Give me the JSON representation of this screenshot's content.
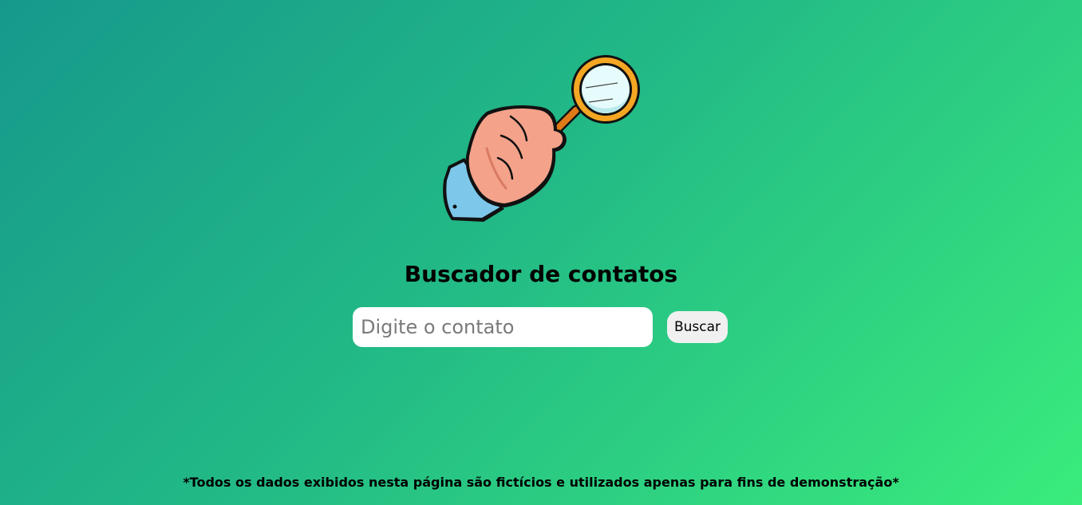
{
  "hero": {
    "icon": "hand-holding-magnifying-glass-icon"
  },
  "page": {
    "title": "Buscador de contatos"
  },
  "search": {
    "placeholder": "Digite o contato",
    "value": "",
    "button_label": "Buscar"
  },
  "footer": {
    "disclaimer": "*Todos os dados exibidos nesta página são fictícios e utilizados apenas para fins de demonstração*"
  },
  "colors": {
    "gradient_start": "#16998c",
    "gradient_end": "#3aec7c",
    "input_background": "#ffffff",
    "button_background": "#f0f0f0"
  }
}
